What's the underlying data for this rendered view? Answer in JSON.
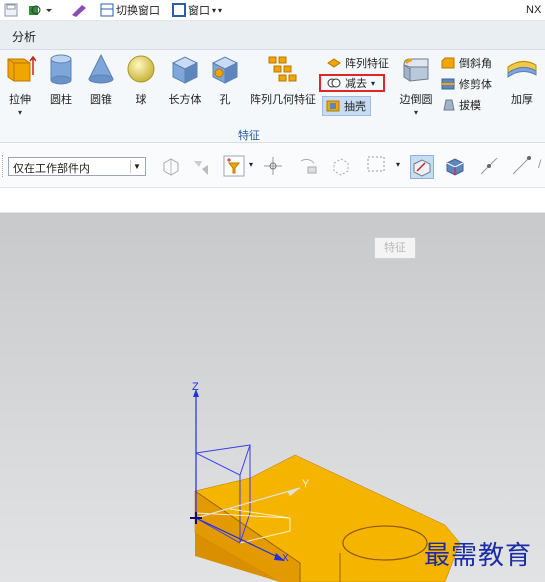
{
  "qat": {
    "switch_window": "切换窗口",
    "window": "窗口",
    "app_brand": "NX"
  },
  "tabs": {
    "analysis": "分析"
  },
  "ribbon": {
    "group_label": "特征",
    "big_buttons": [
      {
        "label": "拉伸",
        "icon": "extrude-icon",
        "has_dropdown": true
      },
      {
        "label": "圆柱",
        "icon": "cylinder-icon",
        "has_dropdown": false
      },
      {
        "label": "圆锥",
        "icon": "cone-icon",
        "has_dropdown": false
      },
      {
        "label": "球",
        "icon": "sphere-icon",
        "has_dropdown": false
      },
      {
        "label": "长方体",
        "icon": "block-icon",
        "has_dropdown": false
      },
      {
        "label": "孔",
        "icon": "hole-icon",
        "has_dropdown": false
      },
      {
        "label": "阵列几何特征",
        "icon": "pattern-geometry-icon",
        "has_dropdown": false
      }
    ],
    "small_buttons": {
      "pattern_feature": "阵列特征",
      "subtract": "减去",
      "shell": "抽壳",
      "edge_blend": "边倒圆",
      "chamfer": "倒斜角",
      "trim_body": "修剪体",
      "draft": "拔模",
      "thicken": "加厚"
    },
    "highlight_color": "#e0262a"
  },
  "selection_bar": {
    "filter_value": "仅在工作部件内",
    "tooltip": "特征"
  },
  "viewport": {
    "axis_z": "Z",
    "axis_y": "Y",
    "axis_x": "X",
    "part_color": "#f5b400",
    "watermark": "最需教育"
  }
}
